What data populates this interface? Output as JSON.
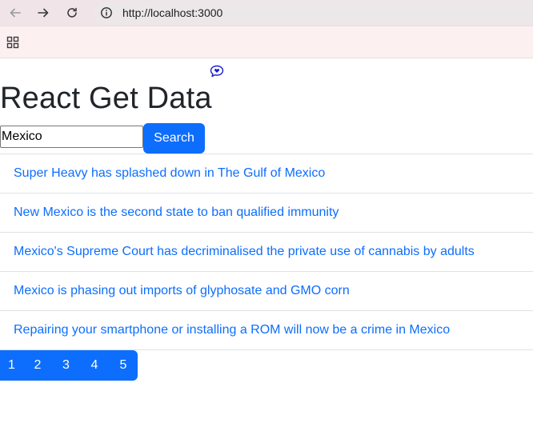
{
  "browser": {
    "url": "http://localhost:3000",
    "icons": {
      "back": "back-arrow-icon",
      "forward": "forward-arrow-icon",
      "reload": "reload-icon",
      "site_info": "site-info-icon",
      "apps": "apps-grid-icon"
    }
  },
  "page": {
    "title": "React Get Data",
    "extension_icon": "chat-bubble-icon",
    "search": {
      "value": "Mexico",
      "button_label": "Search"
    },
    "results": [
      "Super Heavy has splashed down in The Gulf of Mexico",
      "New Mexico is the second state to ban qualified immunity",
      "Mexico's Supreme Court has decriminalised the private use of cannabis by adults",
      "Mexico is phasing out imports of glyphosate and GMO corn",
      "Repairing your smartphone or installing a ROM will now be a crime in Mexico"
    ],
    "pagination": [
      "1",
      "2",
      "3",
      "4",
      "5"
    ]
  },
  "colors": {
    "accent": "#0d6efd",
    "toolbar_bg": "#f1e4e8",
    "bookmarks_bg": "#fdf0f1",
    "title_text": "#212529"
  }
}
